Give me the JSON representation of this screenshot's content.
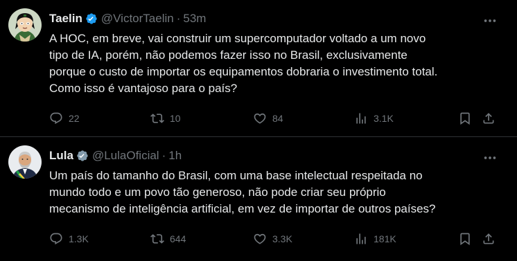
{
  "tweets": [
    {
      "name": "Taelin",
      "handle": "@VictorTaelin",
      "separator": "·",
      "time": "53m",
      "avatar_icon": "avatar-animated-character",
      "text_lines": [
        "A HOC, em breve, vai construir um supercomputador voltado a um novo",
        "tipo de IA, porém, não podemos fazer isso no Brasil, exclusivamente",
        "porque o custo de importar os equipamentos dobraria o investimento total.",
        "Como isso é vantajoso para o país?"
      ],
      "replies": "22",
      "reposts": "10",
      "likes": "84",
      "views": "3.1K"
    },
    {
      "name": "Lula",
      "handle": "@LulaOficial",
      "separator": "·",
      "time": "1h",
      "avatar_icon": "avatar-person-photo",
      "text_lines": [
        "Um país do tamanho do Brasil, com uma base intelectual respeitada no",
        "mundo todo e um povo tão generoso, não pode criar seu próprio",
        "mecanismo de inteligência artificial, em vez de importar de outros países?"
      ],
      "replies": "1.3K",
      "reposts": "644",
      "likes": "3.3K",
      "views": "181K"
    }
  ],
  "colors": {
    "background": "#000000",
    "text": "#e7e9ea",
    "secondary": "#71767b",
    "verified": "#1d9bf0",
    "divider": "#2f3336"
  }
}
